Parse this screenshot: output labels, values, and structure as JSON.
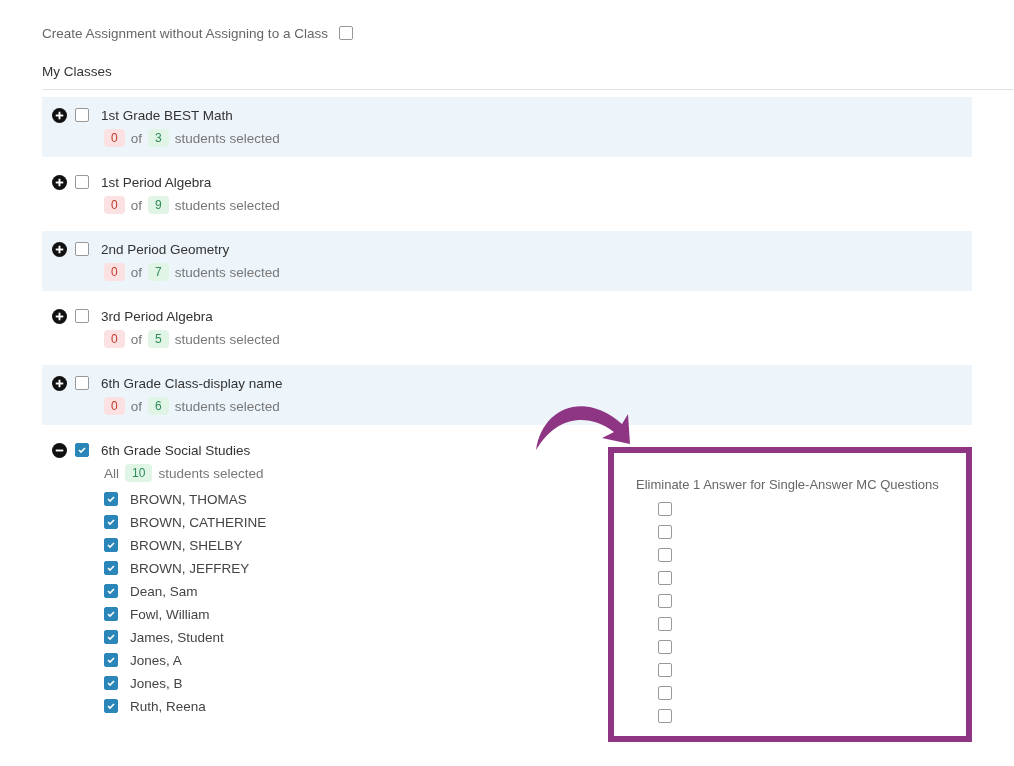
{
  "no_class_option": {
    "label": "Create Assignment without Assigning to a Class",
    "checked": false
  },
  "section_title": "My Classes",
  "classes": [
    {
      "name": "1st Grade BEST Math",
      "checked": false,
      "expanded": false,
      "selected": {
        "kind": "badge",
        "text": "0"
      },
      "of": "of",
      "total": "3",
      "suffix": "students selected"
    },
    {
      "name": "1st Period Algebra",
      "checked": false,
      "expanded": false,
      "selected": {
        "kind": "badge",
        "text": "0"
      },
      "of": "of",
      "total": "9",
      "suffix": "students selected"
    },
    {
      "name": "2nd Period Geometry",
      "checked": false,
      "expanded": false,
      "selected": {
        "kind": "badge",
        "text": "0"
      },
      "of": "of",
      "total": "7",
      "suffix": "students selected"
    },
    {
      "name": "3rd Period Algebra",
      "checked": false,
      "expanded": false,
      "selected": {
        "kind": "badge",
        "text": "0"
      },
      "of": "of",
      "total": "5",
      "suffix": "students selected"
    },
    {
      "name": "6th Grade Class-display name",
      "checked": false,
      "expanded": false,
      "selected": {
        "kind": "badge",
        "text": "0"
      },
      "of": "of",
      "total": "6",
      "suffix": "students selected"
    },
    {
      "name": "6th Grade Social Studies",
      "checked": true,
      "expanded": true,
      "selected": {
        "kind": "word",
        "text": "All"
      },
      "total": "10",
      "suffix": "students selected",
      "option_heading": "Eliminate 1 Answer for Single-Answer MC Questions",
      "students": [
        {
          "name": "BROWN, THOMAS",
          "checked": true,
          "eliminate": false
        },
        {
          "name": "BROWN, CATHERINE",
          "checked": true,
          "eliminate": false
        },
        {
          "name": "BROWN, SHELBY",
          "checked": true,
          "eliminate": false
        },
        {
          "name": "BROWN, JEFFREY",
          "checked": true,
          "eliminate": false
        },
        {
          "name": "Dean, Sam",
          "checked": true,
          "eliminate": false
        },
        {
          "name": "Fowl, William",
          "checked": true,
          "eliminate": false
        },
        {
          "name": "James, Student",
          "checked": true,
          "eliminate": false
        },
        {
          "name": "Jones, A",
          "checked": true,
          "eliminate": false
        },
        {
          "name": "Jones, B",
          "checked": true,
          "eliminate": false
        },
        {
          "name": "Ruth, Reena",
          "checked": true,
          "eliminate": false
        }
      ]
    }
  ]
}
